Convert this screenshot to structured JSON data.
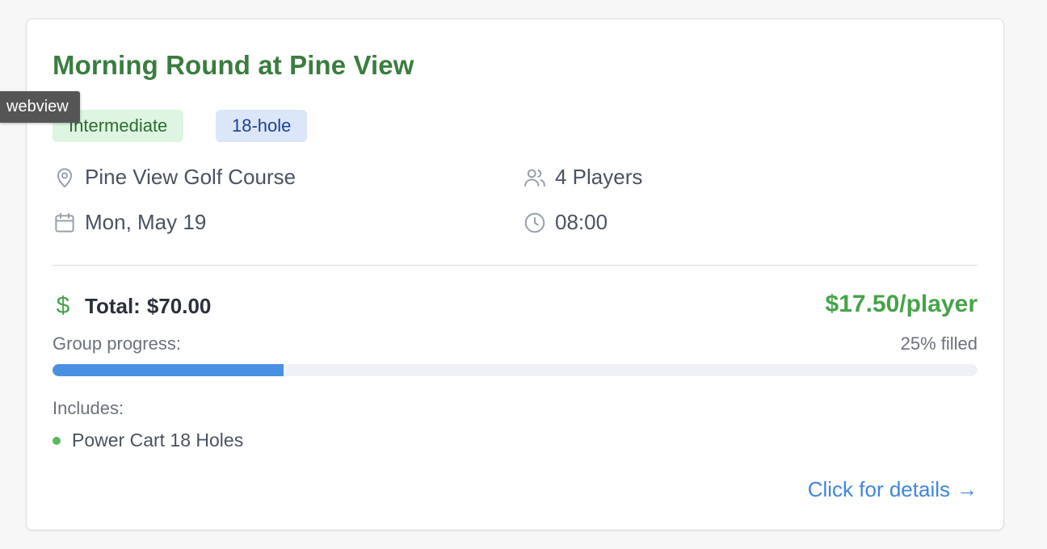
{
  "card": {
    "title": "Morning Round at Pine View",
    "badges": {
      "level": "Intermediate",
      "holes": "18-hole"
    },
    "info": {
      "location": "Pine View Golf Course",
      "players": "4 Players",
      "date": "Mon, May 19",
      "time": "08:00"
    },
    "pricing": {
      "total_label": "Total:",
      "total_value": "$70.00",
      "per_player": "$17.50/player"
    },
    "progress": {
      "label": "Group progress:",
      "status": "25% filled",
      "percent": 25
    },
    "includes": {
      "label": "Includes:",
      "items": [
        "Power Cart 18 Holes"
      ]
    },
    "details_link": "Click for details",
    "details_arrow": "→"
  },
  "tooltip": "webview",
  "icons": {
    "dollar": "$",
    "location": "map-pin-icon",
    "players": "users-icon",
    "date": "calendar-icon",
    "time": "clock-icon"
  },
  "colors": {
    "title": "#3a7d3f",
    "accent_green": "#45a449",
    "progress_fill": "#4a90e2",
    "link": "#3f86e0"
  }
}
